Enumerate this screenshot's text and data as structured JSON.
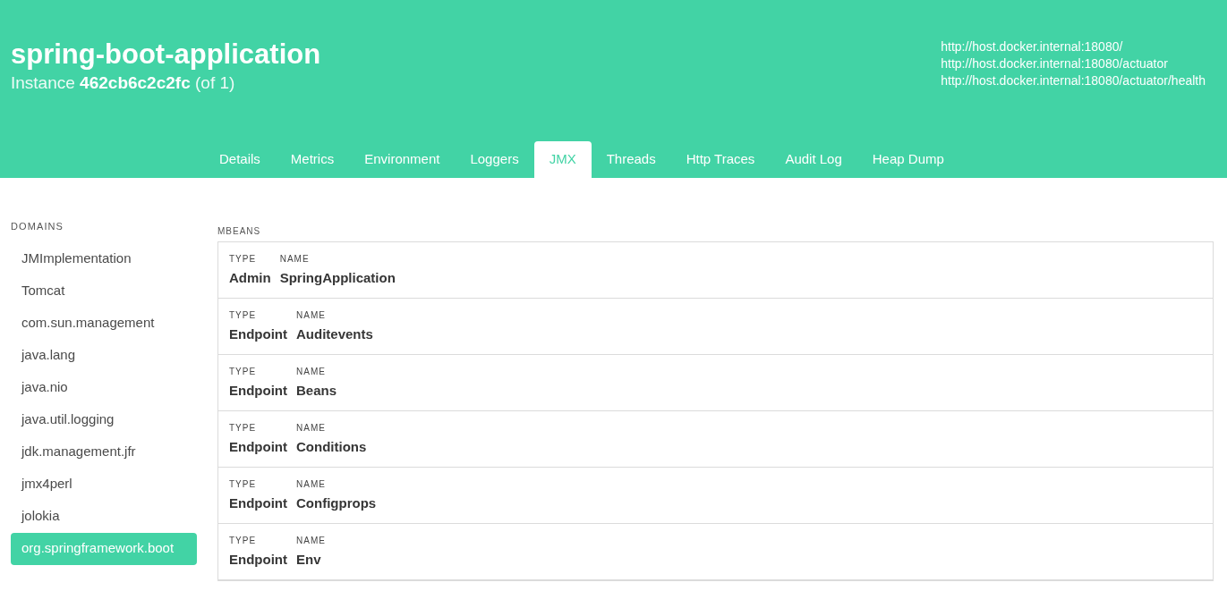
{
  "header": {
    "title": "spring-boot-application",
    "instance_label": "Instance",
    "instance_id": "462cb6c2c2fc",
    "instance_count": "(of 1)",
    "links": [
      "http://host.docker.internal:18080/",
      "http://host.docker.internal:18080/actuator",
      "http://host.docker.internal:18080/actuator/health"
    ]
  },
  "tabs": [
    {
      "label": "Details",
      "selected": false
    },
    {
      "label": "Metrics",
      "selected": false
    },
    {
      "label": "Environment",
      "selected": false
    },
    {
      "label": "Loggers",
      "selected": false
    },
    {
      "label": "JMX",
      "selected": true
    },
    {
      "label": "Threads",
      "selected": false
    },
    {
      "label": "Http Traces",
      "selected": false
    },
    {
      "label": "Audit Log",
      "selected": false
    },
    {
      "label": "Heap Dump",
      "selected": false
    }
  ],
  "domains": {
    "heading": "DOMAINS",
    "items": [
      {
        "label": "JMImplementation",
        "selected": false
      },
      {
        "label": "Tomcat",
        "selected": false
      },
      {
        "label": "com.sun.management",
        "selected": false
      },
      {
        "label": "java.lang",
        "selected": false
      },
      {
        "label": "java.nio",
        "selected": false
      },
      {
        "label": "java.util.logging",
        "selected": false
      },
      {
        "label": "jdk.management.jfr",
        "selected": false
      },
      {
        "label": "jmx4perl",
        "selected": false
      },
      {
        "label": "jolokia",
        "selected": false
      },
      {
        "label": "org.springframework.boot",
        "selected": true
      }
    ]
  },
  "mbeans": {
    "heading": "MBEANS",
    "rows": [
      {
        "type_label": "TYPE",
        "name_label": "NAME",
        "type": "Admin",
        "name": "SpringApplication"
      },
      {
        "type_label": "TYPE",
        "name_label": "NAME",
        "type": "Endpoint",
        "name": "Auditevents"
      },
      {
        "type_label": "TYPE",
        "name_label": "NAME",
        "type": "Endpoint",
        "name": "Beans"
      },
      {
        "type_label": "TYPE",
        "name_label": "NAME",
        "type": "Endpoint",
        "name": "Conditions"
      },
      {
        "type_label": "TYPE",
        "name_label": "NAME",
        "type": "Endpoint",
        "name": "Configprops"
      },
      {
        "type_label": "TYPE",
        "name_label": "NAME",
        "type": "Endpoint",
        "name": "Env"
      }
    ]
  }
}
